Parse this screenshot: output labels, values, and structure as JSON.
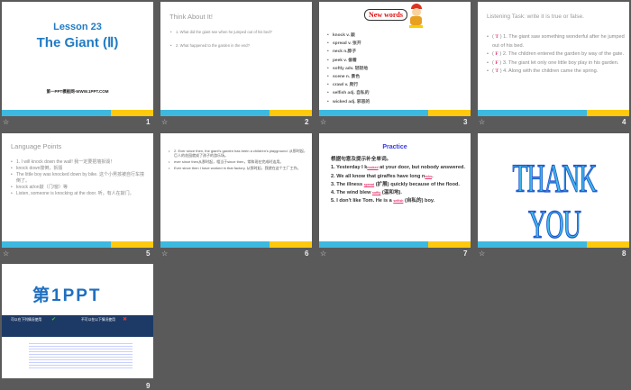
{
  "slides": [
    {
      "number": "1",
      "lesson": "Lesson 23",
      "title": "The Giant (Ⅱ)",
      "footer": "第一PPT模板网-WWW.1PPT.COM"
    },
    {
      "number": "2",
      "heading": "Think About It!",
      "items": [
        "1. What did the giant see when he jumped out of his bed?",
        "2. What happened to the garden in the end?"
      ]
    },
    {
      "number": "3",
      "banner": "New words",
      "items": [
        "knock v. 敲",
        "spread v. 张开",
        "neck n.脖子",
        "peek v. 偷看",
        "softly adv. 轻轻地",
        "scene n. 景色",
        "crawl v. 爬行",
        "selfish adj. 自私的",
        "wicked adj. 邪恶的"
      ]
    },
    {
      "number": "4",
      "heading": "Listening Task:  write it is true or false.",
      "items": [
        {
          "mark": "T",
          "text": "1. The giant saw something wonderful after he jumped out of his bed."
        },
        {
          "mark": "F",
          "text": "2. The children entered the garden by way of the gate."
        },
        {
          "mark": "F",
          "text": "3. The giant let only one little boy play in his garden."
        },
        {
          "mark": "T",
          "text": "4. Along with the children came the spring."
        }
      ]
    },
    {
      "number": "5",
      "heading": "Language Points",
      "items": [
        "1. I will knock down the wall! 我一定要把墙拆毁！",
        "knock down撞倒，拆毁",
        "The little boy was knocked down by bike. 这个小男孩被自行车撞倒了。",
        "knock at/on敲（门/窗）等",
        "Listen, someone is knocking at the door. 听，有人在敲门。"
      ]
    },
    {
      "number": "6",
      "items": [
        "2. Ever since then, the giant's garden has been a children's playground. 从那时起，巨人的花园就成了孩子的游乐场。",
        "ever since then从那时起，相当于since then，常和现在完成时连用。",
        "Ever since then I have worked in that factory. 从那时起，我就在这个工厂工作。"
      ]
    },
    {
      "number": "7",
      "heading": "Practice",
      "instruction": "根据句意及提示补全单词。",
      "lines": [
        {
          "pre": "1. Yesterday I k",
          "blank": "nocked",
          "post": " at your door, but nobody answered."
        },
        {
          "pre": "2. We all know that giraffes have long n",
          "blank": "ecks",
          "post": "."
        },
        {
          "pre": "3. The illness ",
          "blank": "spread",
          "post": " (扩展) quickly because of the flood."
        },
        {
          "pre": "4. The wind blew ",
          "blank": "softly",
          "post": " (温和地)."
        },
        {
          "pre": "5. I don't like Tom. He is a ",
          "blank": "selfish",
          "post": " (自私的) boy."
        }
      ]
    },
    {
      "number": "8",
      "text": "THANK YOU"
    },
    {
      "number": "9",
      "logo": "第1PPT",
      "left_heading": "可以在下列情况使用",
      "right_heading": "不可以在以下情况使用"
    }
  ],
  "colors": {
    "blue_bar": "#3db9e0",
    "yellow_bar": "#ffc90e",
    "title_blue": "#1f7bc4"
  }
}
